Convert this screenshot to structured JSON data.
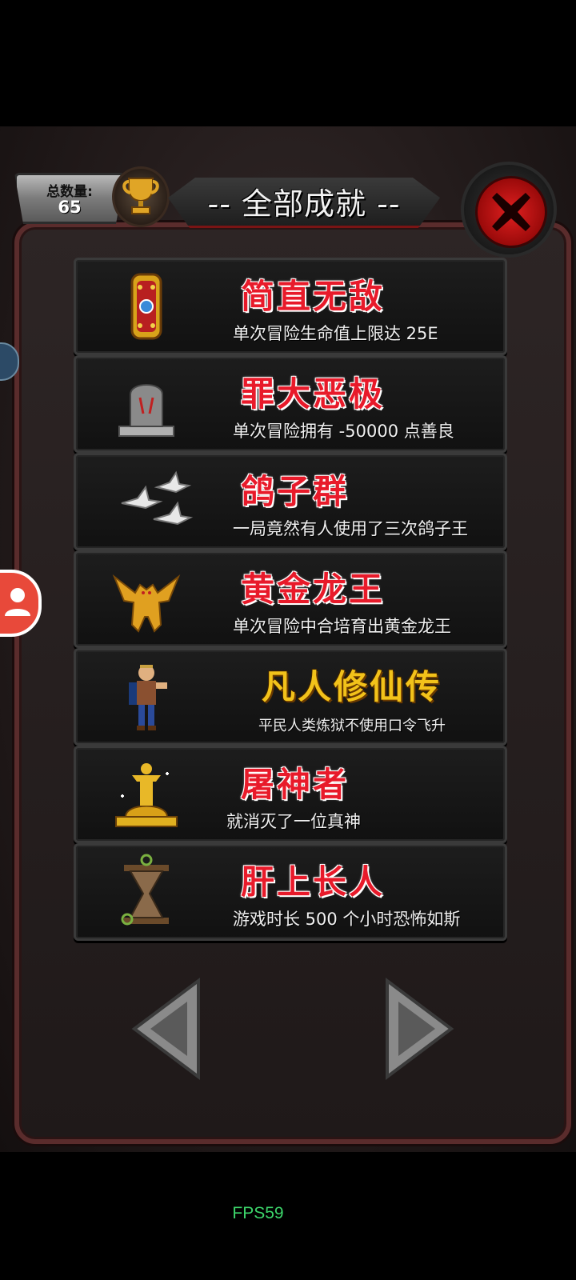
{
  "header": {
    "count_label": "总数量:",
    "count_value": "65",
    "title": "-- 全部成就 --"
  },
  "achievements": [
    {
      "title": "简直无敌",
      "desc": "单次冒险生命值上限达 25E",
      "icon": "golden-shield-icon",
      "style": "red"
    },
    {
      "title": "罪大恶极",
      "desc": "单次冒险拥有 -50000 点善良",
      "icon": "tombstone-icon",
      "style": "red"
    },
    {
      "title": "鸽子群",
      "desc": "一局竟然有人使用了三次鸽子王",
      "icon": "pigeon-flock-icon",
      "style": "red"
    },
    {
      "title": "黄金龙王",
      "desc": "单次冒险中合培育出黄金龙王",
      "icon": "golden-dragon-icon",
      "style": "red"
    },
    {
      "title": "凡人修仙传",
      "desc": "平民人类炼狱不使用口令飞升",
      "icon": "peasant-icon",
      "style": "gold"
    },
    {
      "title": "屠神者",
      "desc": "就消灭了一位真神",
      "icon": "golden-statue-icon",
      "style": "red"
    },
    {
      "title": "肝上长人",
      "desc": "游戏时长 500 个小时恐怖如斯",
      "icon": "hourglass-icon",
      "style": "red"
    }
  ],
  "footer": {
    "fps": "FPS59"
  },
  "colors": {
    "title_red": "#e81a2a",
    "title_gold": "#f2c21a",
    "close_red": "#e02020",
    "fps_green": "#3cd46a"
  }
}
